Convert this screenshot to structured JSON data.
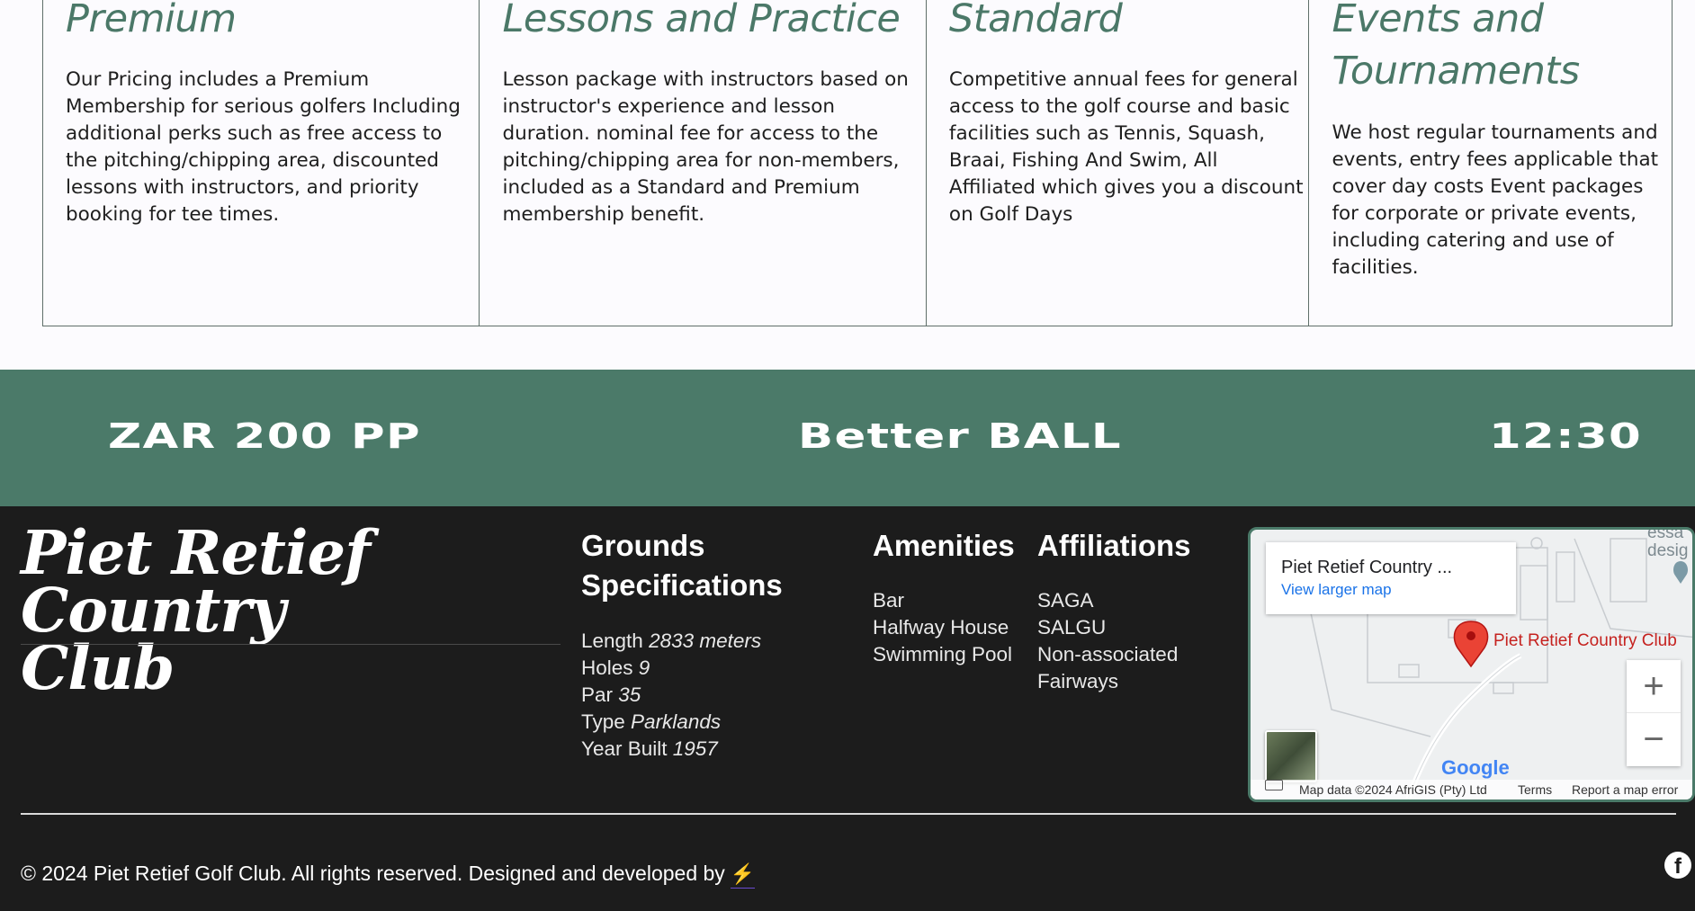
{
  "cards": [
    {
      "title_lines": [
        "Premium"
      ],
      "body_lines": [
        "Our Pricing includes a Premium",
        "Membership for serious golfers Including",
        "additional perks such as free access to",
        "the pitching/chipping area, discounted",
        "lessons with instructors, and priority",
        "booking for tee times."
      ]
    },
    {
      "title_lines": [
        "Lessons and Practice"
      ],
      "body_lines": [
        "Lesson package with instructors based on",
        "instructor's experience and lesson",
        "duration. nominal fee for access to the",
        "pitching/chipping area for non-members,",
        "included as a Standard and Premium",
        "membership benefit."
      ]
    },
    {
      "title_lines": [
        "Standard"
      ],
      "body_lines": [
        "Competitive annual fees for general",
        "access to the golf course and basic",
        "facilities such as Tennis, Squash,",
        "Braai, Fishing And Swim, All",
        "Affiliated which gives you a discount",
        "on Golf Days"
      ]
    },
    {
      "title_lines": [
        "Events and",
        "Tournaments"
      ],
      "body_lines": [
        "We host regular tournaments and",
        "events, entry fees applicable that",
        "cover day costs Event packages",
        "for corporate or private events,",
        "including catering and use of",
        "facilities."
      ]
    }
  ],
  "band": {
    "price": "ZAR 200 PP",
    "format": "Better BALL",
    "time": "12:30",
    "color": "#4b7a69"
  },
  "footer": {
    "brand_lines": [
      "Piet Retief Country",
      "Club"
    ],
    "grounds": {
      "heading_lines": [
        "Grounds",
        "Specifications"
      ],
      "items": [
        {
          "label": "Length",
          "value": "2833 meters"
        },
        {
          "label": "Holes",
          "value": "9"
        },
        {
          "label": "Par",
          "value": "35"
        },
        {
          "label": "Type",
          "value": "Parklands"
        },
        {
          "label": "Year Built",
          "value": "1957"
        }
      ]
    },
    "amenities": {
      "heading": "Amenities",
      "items": [
        "Bar",
        "Halfway House",
        "Swimming Pool"
      ]
    },
    "affiliations": {
      "heading": "Affiliations",
      "items": [
        "SAGA",
        "SALGU",
        "Non-associated",
        "Fairways"
      ]
    },
    "copyright": "© 2024 Piet Retief Golf Club. All rights reserved. Designed and developed by",
    "bolt_icon": "⚡",
    "facebook_icon": "f"
  },
  "map": {
    "place_title": "Piet Retief Country ...",
    "larger_map_link": "View larger map",
    "pin_label": "Piet Retief Country Club",
    "corner_text_lines": [
      "essa",
      "desig"
    ],
    "zoom_in": "+",
    "zoom_out": "−",
    "google_logo": "Google",
    "map_data": "Map data ©2024 AfriGIS (Pty) Ltd",
    "terms": "Terms",
    "report": "Report a map error",
    "pin_color": "#ea4335"
  }
}
